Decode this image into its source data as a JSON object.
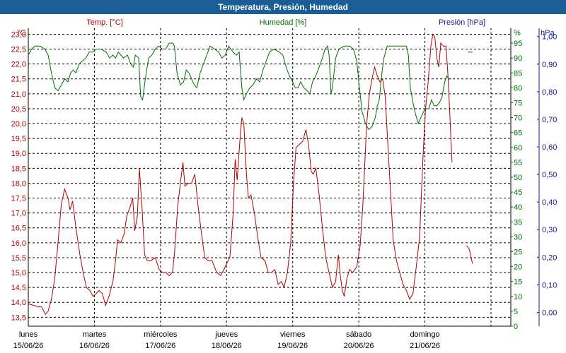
{
  "window": {
    "title": "Temperatura, Presión, Humedad"
  },
  "colors": {
    "temperature": "#b00000",
    "humidity": "#007000",
    "pressure": "#1a1a8c",
    "grid": "#000000",
    "title_bg": "#1b5e95"
  },
  "chart_data": {
    "type": "line",
    "grid": true,
    "axes": {
      "temperature": {
        "series_label": "Temp. [°C]",
        "unit": "°C",
        "side": "left",
        "range": [
          13.2,
          23.2
        ],
        "ticks": [
          "13,5",
          "14,0",
          "14,5",
          "15,0",
          "15,5",
          "16,0",
          "16,5",
          "17,0",
          "17,5",
          "18,0",
          "18,5",
          "19,0",
          "19,5",
          "20,0",
          "20,5",
          "21,0",
          "21,5",
          "22,0",
          "22,5",
          "23,0"
        ]
      },
      "humidity": {
        "series_label": "Humedad [%]",
        "unit": "%",
        "side": "right",
        "range": [
          0,
          100
        ],
        "ticks": [
          "0",
          "5",
          "10",
          "15",
          "20",
          "25",
          "30",
          "35",
          "40",
          "45",
          "50",
          "55",
          "60",
          "65",
          "70",
          "75",
          "80",
          "85",
          "90",
          "95"
        ]
      },
      "pressure": {
        "series_label": "Presión [hPa]",
        "unit": "hPa",
        "side": "right",
        "range": [
          -0.05,
          1.03
        ],
        "ticks": [
          "0,00",
          "0,10",
          "0,20",
          "0,30",
          "0,40",
          "0,50",
          "0,60",
          "0,70",
          "0,80",
          "0,90",
          "1,00"
        ]
      }
    },
    "x_range_days": [
      0,
      7.3
    ],
    "days": [
      {
        "weekday": "lunes",
        "date": "15/06/26"
      },
      {
        "weekday": "martes",
        "date": "16/06/26"
      },
      {
        "weekday": "miércoles",
        "date": "17/06/26"
      },
      {
        "weekday": "jueves",
        "date": "18/06/26"
      },
      {
        "weekday": "viernes",
        "date": "19/06/26"
      },
      {
        "weekday": "sábado",
        "date": "20/06/26"
      },
      {
        "weekday": "domingo",
        "date": "21/06/26"
      }
    ],
    "series": [
      {
        "name": "Temp. [°C]",
        "axis": "temperature",
        "points": [
          [
            0.0,
            13.95
          ],
          [
            0.08,
            13.9
          ],
          [
            0.16,
            13.85
          ],
          [
            0.2,
            13.85
          ],
          [
            0.26,
            13.6
          ],
          [
            0.3,
            13.7
          ],
          [
            0.35,
            14.1
          ],
          [
            0.4,
            14.8
          ],
          [
            0.45,
            16.0
          ],
          [
            0.5,
            17.3
          ],
          [
            0.55,
            17.8
          ],
          [
            0.6,
            17.5
          ],
          [
            0.63,
            17.1
          ],
          [
            0.67,
            17.4
          ],
          [
            0.72,
            16.5
          ],
          [
            0.78,
            15.6
          ],
          [
            0.83,
            15.0
          ],
          [
            0.88,
            14.5
          ],
          [
            0.93,
            14.4
          ],
          [
            0.98,
            14.2
          ],
          [
            1.03,
            14.3
          ],
          [
            1.07,
            14.4
          ],
          [
            1.12,
            14.3
          ],
          [
            1.17,
            13.9
          ],
          [
            1.22,
            14.2
          ],
          [
            1.28,
            14.7
          ],
          [
            1.32,
            15.4
          ],
          [
            1.35,
            16.1
          ],
          [
            1.4,
            16.0
          ],
          [
            1.45,
            16.3
          ],
          [
            1.49,
            16.9
          ],
          [
            1.54,
            17.2
          ],
          [
            1.58,
            17.5
          ],
          [
            1.61,
            16.4
          ],
          [
            1.65,
            16.9
          ],
          [
            1.68,
            18.5
          ],
          [
            1.72,
            17.2
          ],
          [
            1.76,
            15.6
          ],
          [
            1.8,
            15.4
          ],
          [
            1.85,
            15.4
          ],
          [
            1.92,
            15.5
          ],
          [
            1.98,
            15.1
          ],
          [
            2.03,
            15.0
          ],
          [
            2.08,
            15.0
          ],
          [
            2.13,
            14.9
          ],
          [
            2.18,
            15.0
          ],
          [
            2.21,
            15.6
          ],
          [
            2.26,
            17.2
          ],
          [
            2.3,
            18.0
          ],
          [
            2.34,
            18.7
          ],
          [
            2.37,
            17.9
          ],
          [
            2.42,
            18.0
          ],
          [
            2.47,
            18.0
          ],
          [
            2.52,
            18.3
          ],
          [
            2.57,
            17.2
          ],
          [
            2.62,
            16.3
          ],
          [
            2.67,
            15.5
          ],
          [
            2.72,
            15.4
          ],
          [
            2.78,
            15.4
          ],
          [
            2.85,
            15.0
          ],
          [
            2.91,
            14.9
          ],
          [
            2.96,
            15.1
          ],
          [
            3.0,
            15.3
          ],
          [
            3.05,
            15.5
          ],
          [
            3.1,
            17.0
          ],
          [
            3.13,
            18.8
          ],
          [
            3.16,
            18.1
          ],
          [
            3.2,
            19.4
          ],
          [
            3.23,
            20.2
          ],
          [
            3.26,
            20.0
          ],
          [
            3.3,
            18.3
          ],
          [
            3.33,
            17.5
          ],
          [
            3.37,
            17.6
          ],
          [
            3.42,
            17.0
          ],
          [
            3.47,
            16.2
          ],
          [
            3.52,
            15.5
          ],
          [
            3.58,
            15.4
          ],
          [
            3.63,
            15.0
          ],
          [
            3.68,
            15.0
          ],
          [
            3.73,
            15.1
          ],
          [
            3.78,
            14.6
          ],
          [
            3.83,
            14.7
          ],
          [
            3.87,
            14.5
          ],
          [
            3.92,
            15.0
          ],
          [
            3.97,
            16.0
          ],
          [
            4.01,
            17.9
          ],
          [
            4.05,
            19.2
          ],
          [
            4.1,
            19.3
          ],
          [
            4.15,
            19.4
          ],
          [
            4.2,
            19.8
          ],
          [
            4.24,
            19.3
          ],
          [
            4.28,
            18.4
          ],
          [
            4.31,
            18.3
          ],
          [
            4.35,
            18.5
          ],
          [
            4.4,
            17.6
          ],
          [
            4.45,
            16.5
          ],
          [
            4.5,
            15.5
          ],
          [
            4.55,
            15.0
          ],
          [
            4.6,
            14.5
          ],
          [
            4.65,
            14.7
          ],
          [
            4.69,
            15.6
          ],
          [
            4.72,
            14.9
          ],
          [
            4.75,
            14.4
          ],
          [
            4.78,
            14.2
          ],
          [
            4.82,
            14.8
          ],
          [
            4.86,
            15.1
          ],
          [
            4.91,
            15.0
          ],
          [
            4.97,
            15.2
          ],
          [
            5.02,
            15.9
          ],
          [
            5.06,
            17.2
          ],
          [
            5.12,
            20.0
          ],
          [
            5.16,
            21.0
          ],
          [
            5.2,
            21.5
          ],
          [
            5.24,
            21.9
          ],
          [
            5.28,
            21.6
          ],
          [
            5.32,
            21.4
          ],
          [
            5.36,
            21.5
          ],
          [
            5.4,
            20.9
          ],
          [
            5.44,
            19.3
          ],
          [
            5.48,
            17.7
          ],
          [
            5.52,
            16.1
          ],
          [
            5.57,
            15.4
          ],
          [
            5.62,
            15.0
          ],
          [
            5.67,
            14.6
          ],
          [
            5.72,
            14.4
          ],
          [
            5.77,
            14.1
          ],
          [
            5.82,
            14.3
          ],
          [
            5.87,
            15.2
          ],
          [
            5.92,
            16.2
          ],
          [
            5.97,
            18.8
          ],
          [
            6.01,
            20.5
          ],
          [
            6.05,
            21.4
          ],
          [
            6.09,
            22.6
          ],
          [
            6.12,
            23.0
          ],
          [
            6.15,
            22.9
          ],
          [
            6.18,
            22.2
          ],
          [
            6.21,
            21.9
          ],
          [
            6.24,
            22.7
          ],
          [
            6.28,
            22.6
          ],
          [
            6.32,
            22.6
          ],
          [
            6.35,
            21.6
          ],
          [
            6.38,
            20.2
          ],
          [
            6.41,
            18.7
          ]
        ],
        "segments_after_gap": [
          [
            6.63,
            15.9
          ],
          [
            6.67,
            15.8
          ],
          [
            6.72,
            15.3
          ]
        ]
      },
      {
        "name": "Humedad [%]",
        "axis": "humidity",
        "points": [
          [
            0.0,
            91
          ],
          [
            0.05,
            93
          ],
          [
            0.1,
            94
          ],
          [
            0.18,
            94
          ],
          [
            0.25,
            93
          ],
          [
            0.3,
            91
          ],
          [
            0.35,
            85
          ],
          [
            0.4,
            80
          ],
          [
            0.45,
            79
          ],
          [
            0.5,
            81
          ],
          [
            0.55,
            83
          ],
          [
            0.6,
            82
          ],
          [
            0.64,
            85
          ],
          [
            0.68,
            86
          ],
          [
            0.72,
            85
          ],
          [
            0.77,
            88
          ],
          [
            0.82,
            89
          ],
          [
            0.87,
            90
          ],
          [
            0.92,
            92
          ],
          [
            0.97,
            92
          ],
          [
            1.03,
            93
          ],
          [
            1.1,
            93
          ],
          [
            1.18,
            92
          ],
          [
            1.23,
            90
          ],
          [
            1.28,
            91
          ],
          [
            1.32,
            90
          ],
          [
            1.36,
            92
          ],
          [
            1.4,
            91
          ],
          [
            1.44,
            90
          ],
          [
            1.5,
            91
          ],
          [
            1.55,
            88
          ],
          [
            1.59,
            87
          ],
          [
            1.62,
            91
          ],
          [
            1.67,
            90
          ],
          [
            1.7,
            77
          ],
          [
            1.73,
            76
          ],
          [
            1.77,
            83
          ],
          [
            1.82,
            90
          ],
          [
            1.87,
            91
          ],
          [
            1.92,
            93
          ],
          [
            1.97,
            94
          ],
          [
            2.03,
            93
          ],
          [
            2.08,
            93
          ],
          [
            2.13,
            95
          ],
          [
            2.19,
            95
          ],
          [
            2.21,
            94
          ],
          [
            2.25,
            85
          ],
          [
            2.3,
            81
          ],
          [
            2.35,
            82
          ],
          [
            2.39,
            86
          ],
          [
            2.43,
            85
          ],
          [
            2.47,
            83
          ],
          [
            2.51,
            81
          ],
          [
            2.55,
            80
          ],
          [
            2.6,
            85
          ],
          [
            2.65,
            88
          ],
          [
            2.7,
            91
          ],
          [
            2.75,
            94
          ],
          [
            2.82,
            93
          ],
          [
            2.88,
            92
          ],
          [
            2.93,
            90
          ],
          [
            2.98,
            91
          ],
          [
            3.03,
            94
          ],
          [
            3.1,
            92
          ],
          [
            3.15,
            91
          ],
          [
            3.19,
            92
          ],
          [
            3.23,
            80
          ],
          [
            3.26,
            76
          ],
          [
            3.3,
            78
          ],
          [
            3.35,
            80
          ],
          [
            3.4,
            81
          ],
          [
            3.45,
            83
          ],
          [
            3.5,
            82
          ],
          [
            3.55,
            86
          ],
          [
            3.6,
            89
          ],
          [
            3.65,
            92
          ],
          [
            3.72,
            93
          ],
          [
            3.8,
            92
          ],
          [
            3.85,
            91
          ],
          [
            3.9,
            87
          ],
          [
            3.95,
            84
          ],
          [
            4.0,
            82
          ],
          [
            4.04,
            80
          ],
          [
            4.08,
            80
          ],
          [
            4.12,
            82
          ],
          [
            4.17,
            80
          ],
          [
            4.22,
            79
          ],
          [
            4.26,
            78
          ],
          [
            4.3,
            82
          ],
          [
            4.35,
            84
          ],
          [
            4.4,
            87
          ],
          [
            4.45,
            90
          ],
          [
            4.49,
            93
          ],
          [
            4.53,
            94
          ],
          [
            4.55,
            91
          ],
          [
            4.58,
            78
          ],
          [
            4.6,
            80
          ],
          [
            4.65,
            90
          ],
          [
            4.7,
            93
          ],
          [
            4.78,
            94
          ],
          [
            4.86,
            94
          ],
          [
            4.92,
            93
          ],
          [
            4.97,
            89
          ],
          [
            5.0,
            82
          ],
          [
            5.05,
            72
          ],
          [
            5.1,
            68
          ],
          [
            5.15,
            66
          ],
          [
            5.2,
            67
          ],
          [
            5.25,
            70
          ],
          [
            5.28,
            74
          ],
          [
            5.31,
            76
          ],
          [
            5.35,
            85
          ],
          [
            5.38,
            90
          ],
          [
            5.43,
            94
          ],
          [
            5.55,
            94
          ],
          [
            5.65,
            94
          ],
          [
            5.72,
            94
          ],
          [
            5.75,
            91
          ],
          [
            5.78,
            80
          ],
          [
            5.82,
            75
          ],
          [
            5.86,
            71
          ],
          [
            5.9,
            68
          ],
          [
            5.94,
            70
          ],
          [
            5.98,
            72
          ],
          [
            6.02,
            73
          ],
          [
            6.06,
            73
          ],
          [
            6.1,
            76
          ],
          [
            6.14,
            74
          ],
          [
            6.18,
            74
          ],
          [
            6.22,
            75
          ],
          [
            6.26,
            77
          ],
          [
            6.3,
            82
          ],
          [
            6.33,
            84
          ],
          [
            6.36,
            83
          ],
          [
            6.4,
            83
          ]
        ],
        "segments_after_gap": [
          [
            6.65,
            92
          ],
          [
            6.72,
            92
          ]
        ]
      }
    ]
  }
}
